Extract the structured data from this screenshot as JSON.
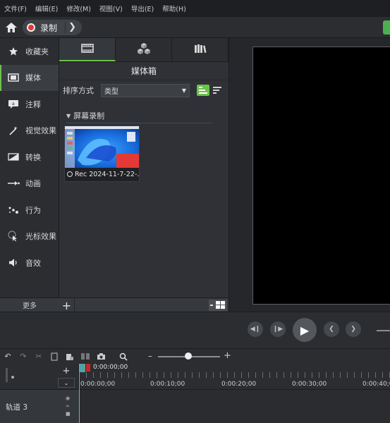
{
  "menu": [
    "文件(F)",
    "编辑(E)",
    "修改(M)",
    "视图(V)",
    "导出(E)",
    "帮助(H)"
  ],
  "toolbar": {
    "record_label": "录制"
  },
  "tools": [
    {
      "name": "favorites",
      "label": "收藏夹",
      "icon": "star-icon"
    },
    {
      "name": "media",
      "label": "媒体",
      "icon": "film-icon"
    },
    {
      "name": "annotations",
      "label": "注释",
      "icon": "annotation-icon"
    },
    {
      "name": "visual-effects",
      "label": "视觉效果",
      "icon": "magic-wand-icon"
    },
    {
      "name": "transitions",
      "label": "转换",
      "icon": "transition-icon"
    },
    {
      "name": "animations",
      "label": "动画",
      "icon": "animation-icon"
    },
    {
      "name": "behaviors",
      "label": "行为",
      "icon": "behavior-icon"
    },
    {
      "name": "cursor-effects",
      "label": "光标效果",
      "icon": "cursor-icon"
    },
    {
      "name": "audio-effects",
      "label": "音效",
      "icon": "speaker-icon"
    }
  ],
  "tools_more": "更多",
  "media_bin": {
    "title": "媒体箱",
    "sort_label": "排序方式",
    "sort_value": "类型",
    "group_title": "屏幕录制",
    "clip_name": "Rec 2024-11-7-22-..."
  },
  "timeline": {
    "playhead_time": "0:00:00;00",
    "track_name": "轨道 3",
    "ticks": [
      "0:00:00;00",
      "0:00:10;00",
      "0:00:20;00",
      "0:00:30;00",
      "0:00:40;0"
    ]
  },
  "colors": {
    "accent": "#6cc24a",
    "record": "#e53935",
    "playhead": "#4fa3a5"
  }
}
